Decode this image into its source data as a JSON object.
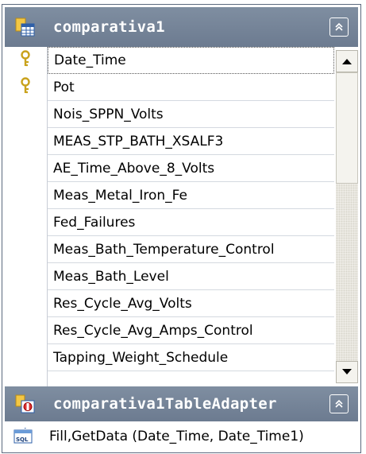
{
  "table": {
    "name": "comparativa1",
    "icon": "table-icon",
    "collapse_icon": "collapse-up-icon",
    "columns": [
      {
        "name": "Date_Time",
        "key": true
      },
      {
        "name": "Pot",
        "key": true
      },
      {
        "name": "Nois_SPPN_Volts",
        "key": false
      },
      {
        "name": "MEAS_STP_BATH_XSALF3",
        "key": false
      },
      {
        "name": "AE_Time_Above_8_Volts",
        "key": false
      },
      {
        "name": "Meas_Metal_Iron_Fe",
        "key": false
      },
      {
        "name": "Fed_Failures",
        "key": false
      },
      {
        "name": "Meas_Bath_Temperature_Control",
        "key": false
      },
      {
        "name": "Meas_Bath_Level",
        "key": false
      },
      {
        "name": "Res_Cycle_Avg_Volts",
        "key": false
      },
      {
        "name": "Res_Cycle_Avg_Amps_Control",
        "key": false
      },
      {
        "name": "Tapping_Weight_Schedule",
        "key": false
      }
    ]
  },
  "adapter": {
    "name": "comparativa1TableAdapter",
    "icon": "table-adapter-icon",
    "collapse_icon": "collapse-up-icon",
    "query_icon": "sql-icon",
    "query": "Fill,GetData (Date_Time, Date_Time1)"
  },
  "colors": {
    "header_bg": "#6c7b90",
    "header_text": "#ffffff",
    "key_icon": "#c9a21c",
    "grid_line": "#d4d9e0"
  }
}
